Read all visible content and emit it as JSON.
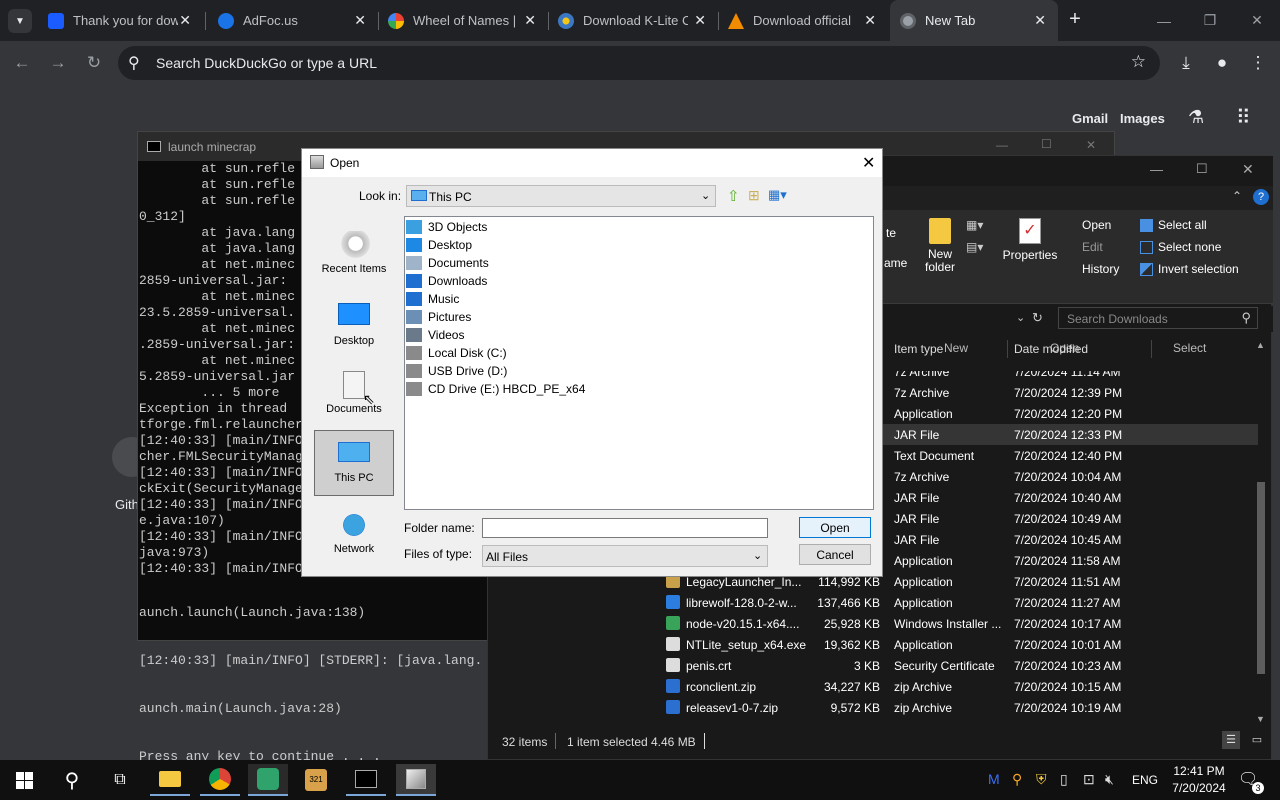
{
  "browser": {
    "tabs": [
      {
        "label": "Thank you for dow",
        "color": "#1a5cff"
      },
      {
        "label": "AdFoc.us",
        "color": "#1b73e8"
      },
      {
        "label": "Wheel of Names |",
        "color": "#e94235"
      },
      {
        "label": "Download K-Lite C",
        "color": "#3b78c4"
      },
      {
        "label": "Download official",
        "color": "#f28b00"
      },
      {
        "label": "New Tab",
        "color": "#9aa0a6"
      }
    ],
    "new_tab_icon": "plus-icon",
    "omnibox_placeholder": "Search DuckDuckGo or type a URL",
    "ntp_links": {
      "gmail": "Gmail",
      "images": "Images"
    }
  },
  "cmd": {
    "title": "launch minecrap",
    "lines": [
      "        at sun.refle",
      "        at sun.refle",
      "        at sun.refle",
      "0_312]",
      "        at java.lang",
      "        at java.lang",
      "        at net.minec",
      "2859-universal.jar:",
      "        at net.minec",
      "23.5.2859-universal.",
      "        at net.minec",
      ".2859-universal.jar:",
      "        at net.minec",
      "5.2859-universal.jar",
      "        ... 5 more",
      "Exception in thread",
      "tforge.fml.relauncher",
      "[12:40:33] [main/INFO",
      "cher.FMLSecurityManag",
      "[12:40:33] [main/INFO",
      "ckExit(SecurityManage",
      "[12:40:33] [main/INFO",
      "e.java:107)",
      "[12:40:33] [main/INFO",
      "java:973)",
      "[12:40:33] [main/INFO",
      "aunch.launch(Launch.java:138)",
      "[12:40:33] [main/INFO] [STDERR]: [java.lang.",
      "aunch.main(Launch.java:28)",
      "Press any key to continue . . ."
    ],
    "desktop_label": "Gith"
  },
  "explorer": {
    "ribbon": {
      "move_label": "te",
      "name_label": "ame",
      "new_folder": "New\nfolder",
      "new_group": "New",
      "properties": "Properties",
      "open": "Open",
      "edit": "Edit",
      "history": "History",
      "open_group": "Open",
      "select_all": "Select all",
      "select_none": "Select none",
      "invert_selection": "Invert selection",
      "select_group": "Select"
    },
    "search_placeholder": "Search Downloads",
    "columns": {
      "type": "Item type",
      "date": "Date modified"
    },
    "top_rows": [
      {
        "type": "7z Archive",
        "date": "7/20/2024 11:14 AM"
      },
      {
        "type": "7z Archive",
        "date": "7/20/2024 12:39 PM"
      },
      {
        "type": "Application",
        "date": "7/20/2024 12:20 PM"
      },
      {
        "type": "JAR File",
        "date": "7/20/2024 12:33 PM"
      },
      {
        "type": "Text Document",
        "date": "7/20/2024 12:40 PM"
      },
      {
        "type": "7z Archive",
        "date": "7/20/2024 10:04 AM"
      },
      {
        "type": "JAR File",
        "date": "7/20/2024 10:40 AM"
      },
      {
        "type": "JAR File",
        "date": "7/20/2024 10:49 AM"
      },
      {
        "type": "JAR File",
        "date": "7/20/2024 10:45 AM"
      },
      {
        "type": "Application",
        "date": "7/20/2024 11:58 AM"
      }
    ],
    "full_rows": [
      {
        "name": "LegacyLauncher_In...",
        "size": "114,992 KB",
        "type": "Application",
        "date": "7/20/2024 11:51 AM"
      },
      {
        "name": "librewolf-128.0-2-w...",
        "size": "137,466 KB",
        "type": "Application",
        "date": "7/20/2024 11:27 AM"
      },
      {
        "name": "node-v20.15.1-x64....",
        "size": "25,928 KB",
        "type": "Windows Installer ...",
        "date": "7/20/2024 10:17 AM"
      },
      {
        "name": "NTLite_setup_x64.exe",
        "size": "19,362 KB",
        "type": "Application",
        "date": "7/20/2024 10:01 AM"
      },
      {
        "name": "penis.crt",
        "size": "3 KB",
        "type": "Security Certificate",
        "date": "7/20/2024 10:23 AM"
      },
      {
        "name": "rconclient.zip",
        "size": "34,227 KB",
        "type": "zip Archive",
        "date": "7/20/2024 10:15 AM"
      },
      {
        "name": "releasev1-0-7.zip",
        "size": "9,572 KB",
        "type": "zip Archive",
        "date": "7/20/2024 10:19 AM"
      }
    ],
    "status": {
      "items": "32 items",
      "selected": "1 item selected",
      "size": "4.46 MB"
    }
  },
  "dialog": {
    "title": "Open",
    "look_in_label": "Look in:",
    "look_in_value": "This PC",
    "places": [
      "Recent Items",
      "Desktop",
      "Documents",
      "This PC",
      "Network"
    ],
    "items": [
      {
        "label": "3D Objects",
        "icon": "3d-objects-icon",
        "color": "#3aa0e0"
      },
      {
        "label": "Desktop",
        "icon": "desktop-folder-icon",
        "color": "#1e88e5"
      },
      {
        "label": "Documents",
        "icon": "documents-icon",
        "color": "#9fb4c8"
      },
      {
        "label": "Downloads",
        "icon": "downloads-icon",
        "color": "#1e6fd0"
      },
      {
        "label": "Music",
        "icon": "music-icon",
        "color": "#1e6fd0"
      },
      {
        "label": "Pictures",
        "icon": "pictures-icon",
        "color": "#6b8fb5"
      },
      {
        "label": "Videos",
        "icon": "videos-icon",
        "color": "#6b7a8a"
      },
      {
        "label": "Local Disk (C:)",
        "icon": "drive-icon",
        "color": "#8a8a8a"
      },
      {
        "label": "USB Drive (D:)",
        "icon": "usb-drive-icon",
        "color": "#8a8a8a"
      },
      {
        "label": "CD Drive (E:) HBCD_PE_x64",
        "icon": "cd-drive-icon",
        "color": "#8a8a8a"
      }
    ],
    "folder_name_label": "Folder name:",
    "folder_name_value": "",
    "files_of_type_label": "Files of type:",
    "files_of_type_value": "All Files",
    "open_button": "Open",
    "cancel_button": "Cancel"
  },
  "taskbar": {
    "language": "ENG",
    "time": "12:41 PM",
    "date": "7/20/2024",
    "notifications": "3"
  }
}
